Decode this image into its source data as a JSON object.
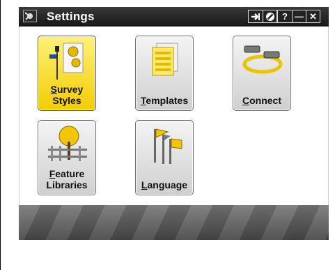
{
  "window": {
    "title": "Settings",
    "buttons": {
      "ok_icon": "arrow-right-icon",
      "cancel_icon": "no-entry-icon",
      "help": "?",
      "minimize": "—",
      "close": "✕"
    }
  },
  "tiles": [
    {
      "id": "survey-styles",
      "line1": "Survey",
      "line2": "Styles",
      "underline": "S",
      "selected": true
    },
    {
      "id": "templates",
      "line1": "Templates",
      "underline": "T",
      "selected": false
    },
    {
      "id": "connect",
      "line1": "Connect",
      "underline": "C",
      "selected": false
    },
    {
      "id": "feature-libraries",
      "line1": "Feature",
      "line2": "Libraries",
      "underline": "F",
      "selected": false
    },
    {
      "id": "language",
      "line1": "Language",
      "underline": "L",
      "selected": false
    }
  ],
  "colors": {
    "accent_yellow": "#f3cc00",
    "titlebar": "#1e1e1e",
    "tile_border": "#6a6a6a"
  }
}
